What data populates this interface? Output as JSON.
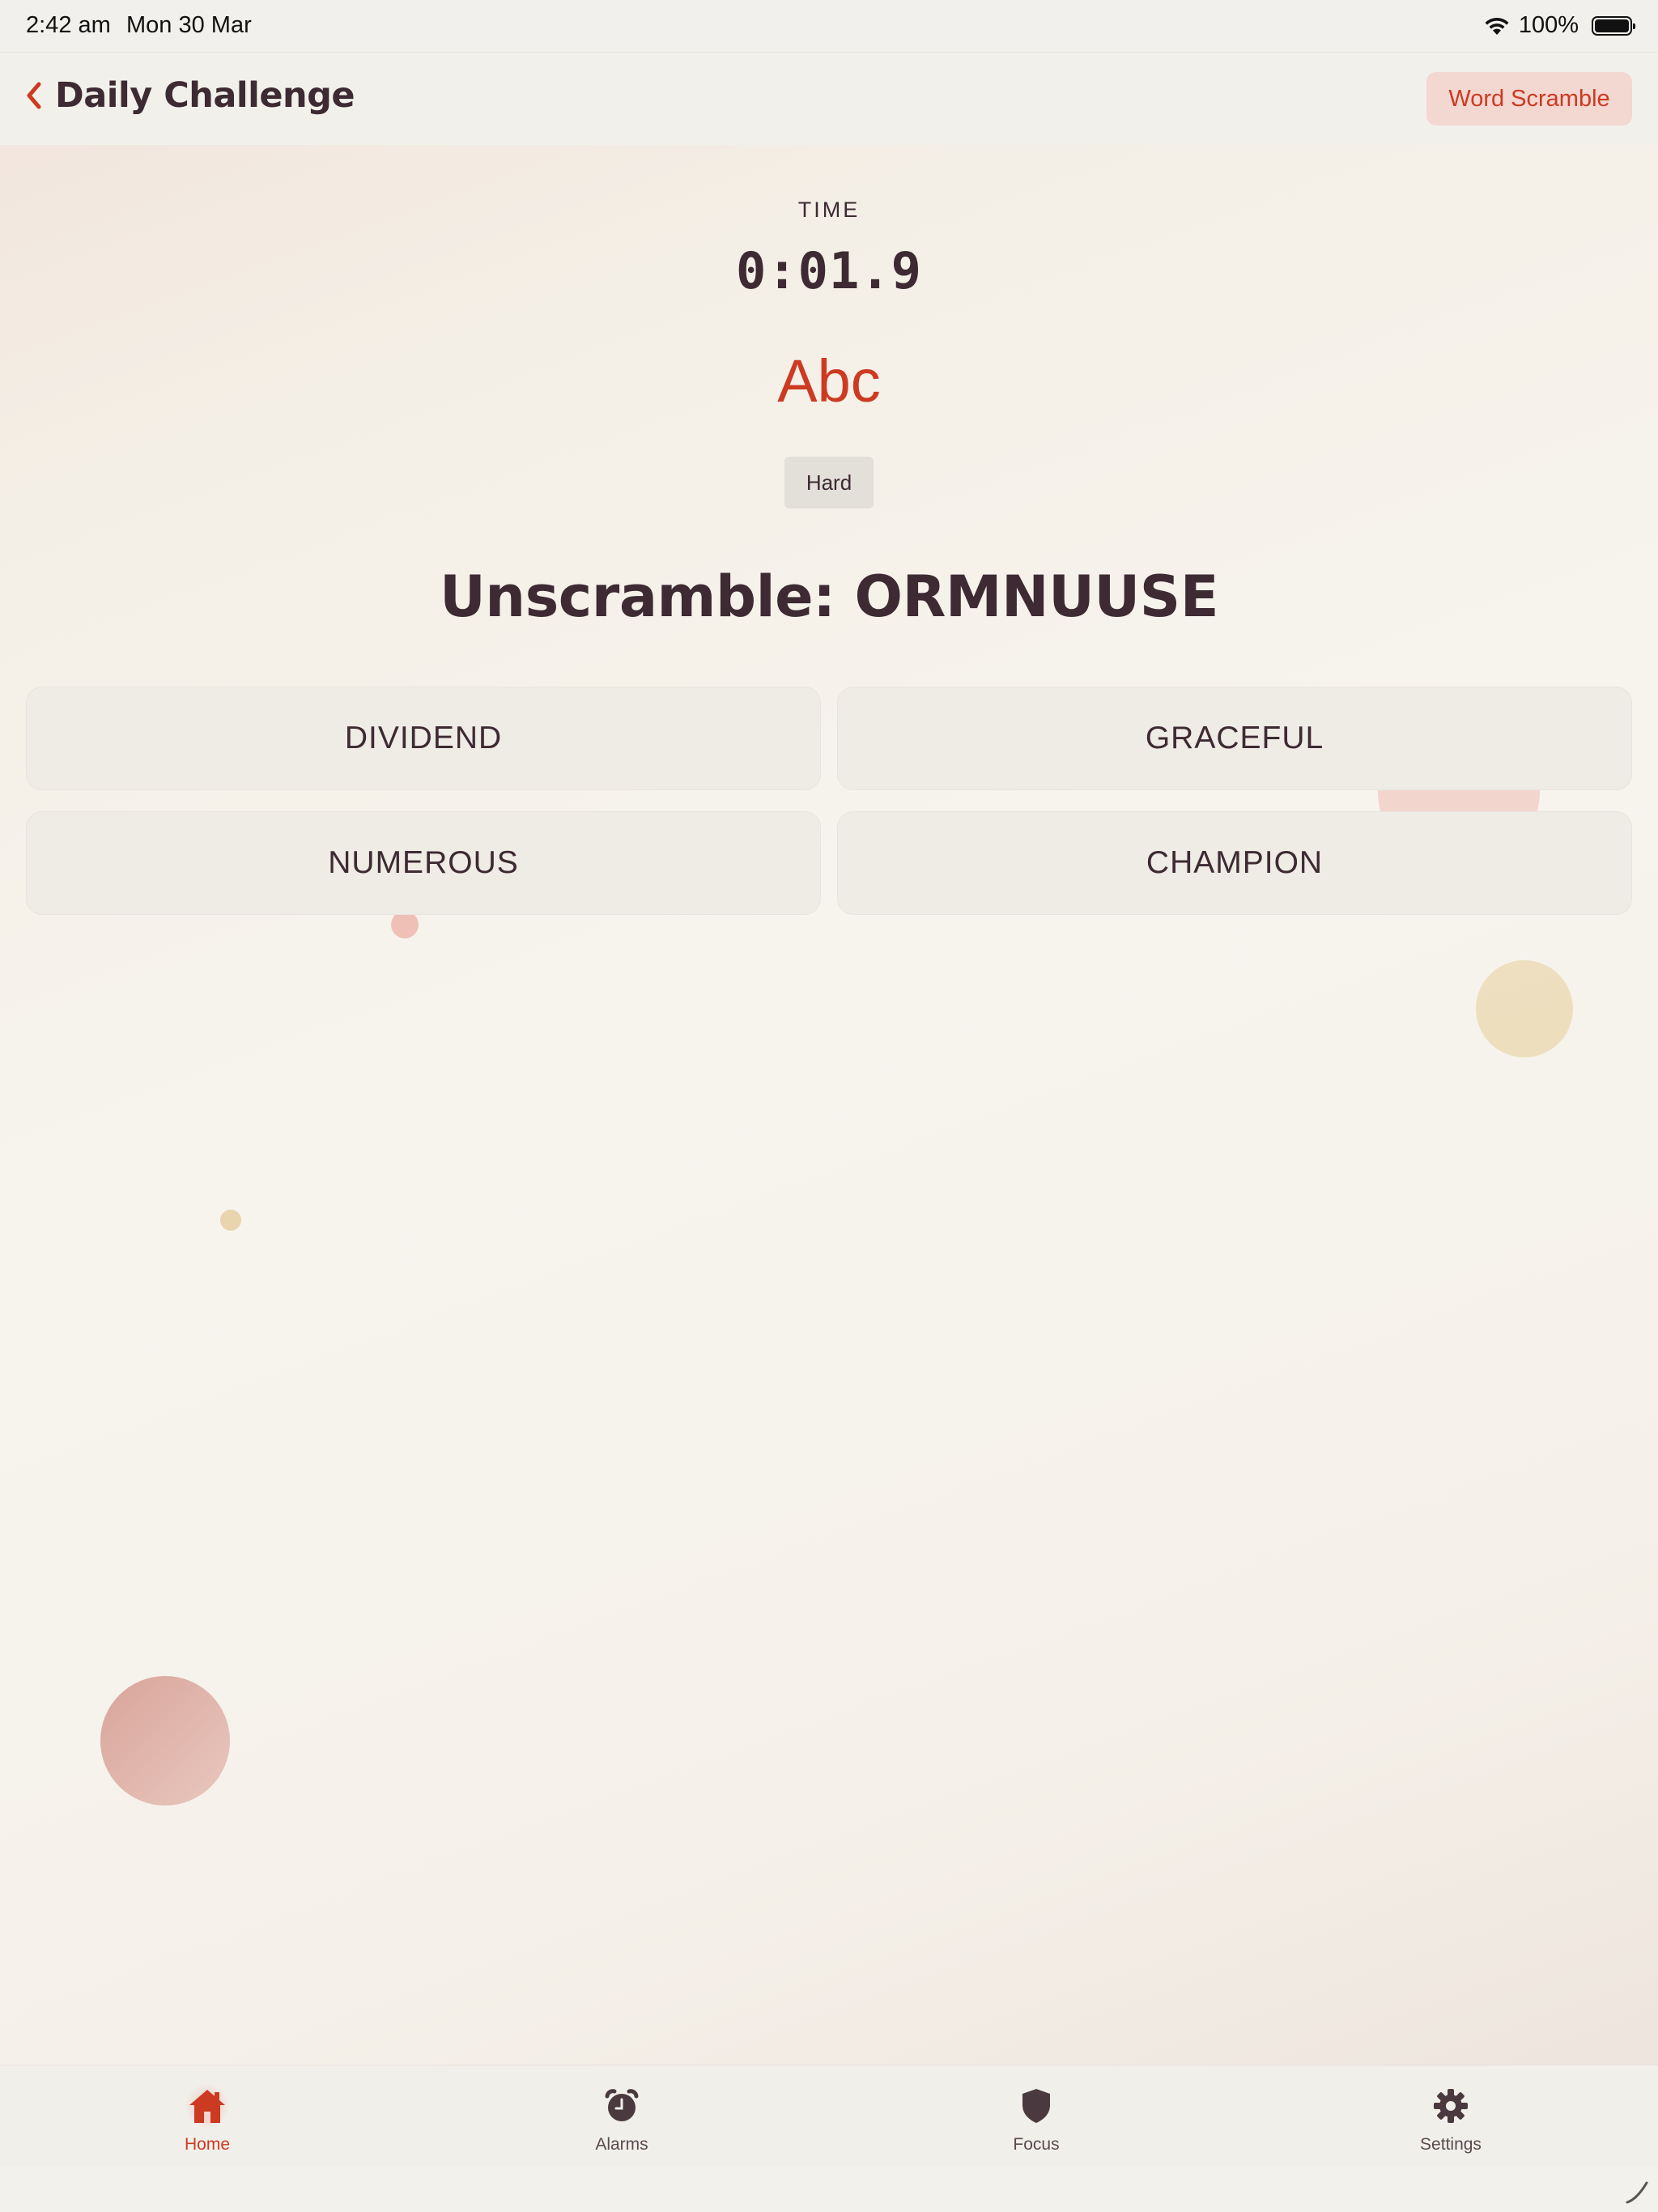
{
  "status_bar": {
    "time": "2:42 am",
    "date": "Mon 30 Mar",
    "battery": "100%"
  },
  "header": {
    "title": "Daily Challenge",
    "mode_label": "Word Scramble"
  },
  "game": {
    "time_label": "TIME",
    "timer": "0:01.9",
    "mode_icon_text": "Abc",
    "difficulty": "Hard",
    "prompt": "Unscramble: ORMNUUSE",
    "options": [
      "DIVIDEND",
      "GRACEFUL",
      "NUMEROUS",
      "CHAMPION"
    ]
  },
  "tabs": [
    {
      "label": "Home",
      "icon": "home-icon",
      "active": true
    },
    {
      "label": "Alarms",
      "icon": "alarm-clock-icon",
      "active": false
    },
    {
      "label": "Focus",
      "icon": "shield-icon",
      "active": false
    },
    {
      "label": "Settings",
      "icon": "gear-icon",
      "active": false
    }
  ],
  "colors": {
    "accent": "#cc3a22",
    "text": "#3d2a33",
    "option_bg": "#efebe5",
    "pill_bg": "#f3d7d1"
  }
}
